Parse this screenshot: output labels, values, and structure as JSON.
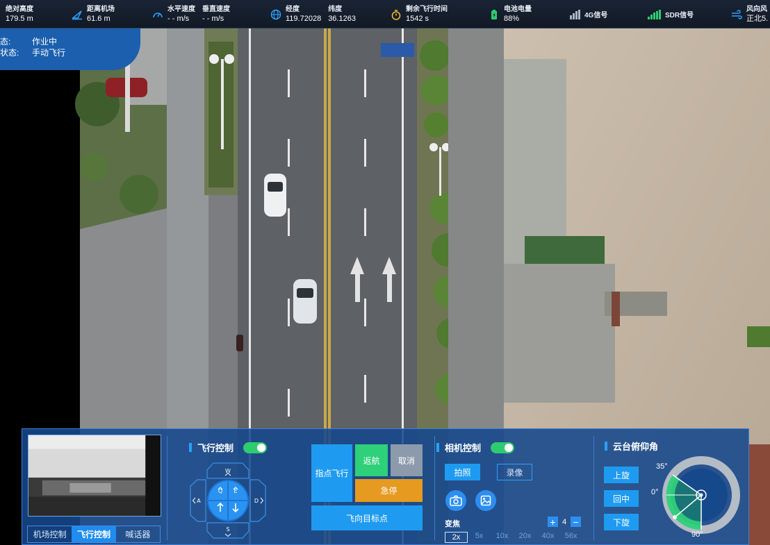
{
  "telemetry": {
    "abs_altitude": {
      "label": "绝对高度",
      "value": "179.5 m"
    },
    "dist_airport": {
      "label": "距离机场",
      "value": "61.6 m"
    },
    "h_speed": {
      "label": "水平速度",
      "value": "- - m/s"
    },
    "v_speed": {
      "label": "垂直速度",
      "value": "- - m/s"
    },
    "longitude": {
      "label": "经度",
      "value": "119.72028"
    },
    "latitude": {
      "label": "纬度",
      "value": "36.1263"
    },
    "remain_time": {
      "label": "剩余飞行时间",
      "value": "1542 s"
    },
    "battery": {
      "label": "电池电量",
      "value": "88%"
    },
    "signal_4g": {
      "label": "4G信号"
    },
    "signal_sdr": {
      "label": "SDR信号"
    },
    "wind": {
      "label": "风向风",
      "value": "正北5."
    }
  },
  "status": {
    "rows": [
      {
        "key": "态:",
        "value": "作业中"
      },
      {
        "key": "状态:",
        "value": "手动飞行"
      }
    ]
  },
  "panel": {
    "tabs": [
      {
        "label": "机场控制",
        "active": false
      },
      {
        "label": "飞行控制",
        "active": true
      },
      {
        "label": "喊话器",
        "active": false
      }
    ],
    "flight": {
      "title": "飞行控制",
      "dpad": {
        "w": "W",
        "a": "A",
        "s": "S",
        "d": "D",
        "q": "Q",
        "e": "E"
      },
      "point_fly": "指点飞行",
      "return": "返航",
      "cancel": "取消",
      "emergency": "急停",
      "fly_to_target": "飞向目标点"
    },
    "camera": {
      "title": "相机控制",
      "photo": "拍照",
      "record": "录像",
      "zoom_label": "变焦",
      "zoom_value": "4",
      "zoom_levels": [
        "2x",
        "5x",
        "10x",
        "20x",
        "40x",
        "56x"
      ],
      "zoom_active": 0
    },
    "gimbal": {
      "title": "云台俯仰角",
      "up": "上旋",
      "center": "回中",
      "down": "下旋",
      "deg_35": "35°",
      "deg_0": "0°",
      "deg_90": "90°"
    }
  },
  "colors": {
    "panel_bg": "#16488c",
    "accent": "#1e9bf0",
    "green": "#2ed07a",
    "orange": "#e69a1f"
  }
}
